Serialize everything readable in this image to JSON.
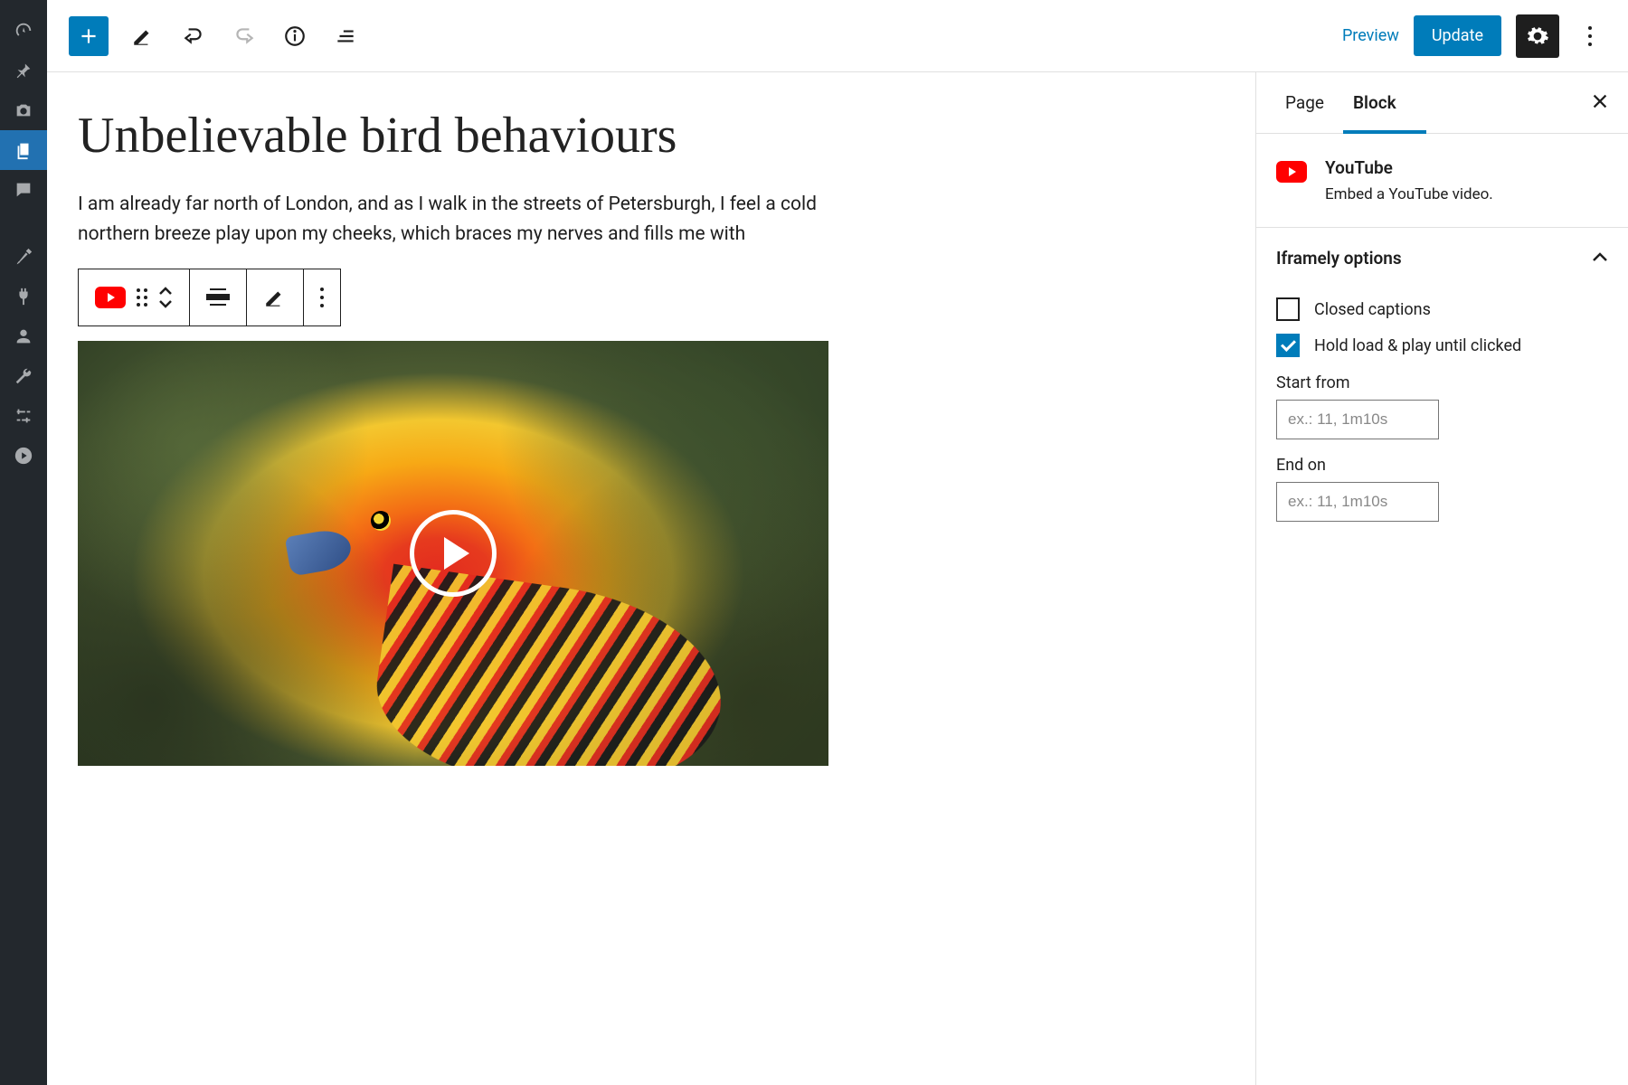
{
  "toolbar": {
    "preview_label": "Preview",
    "update_label": "Update"
  },
  "post": {
    "title": "Unbelievable bird behaviours",
    "paragraph": "I am already far north of London, and as I walk in the streets of Petersburgh, I feel a cold northern breeze play upon my cheeks, which braces my nerves and fills me with"
  },
  "sidebar": {
    "tabs": {
      "page": "Page",
      "block": "Block"
    },
    "block": {
      "name": "YouTube",
      "description": "Embed a YouTube video."
    },
    "section_title": "Iframely options",
    "options": {
      "closed_captions": {
        "label": "Closed captions",
        "checked": false
      },
      "hold_load": {
        "label": "Hold load & play until clicked",
        "checked": true
      }
    },
    "fields": {
      "start": {
        "label": "Start from",
        "placeholder": "ex.: 11, 1m10s",
        "value": ""
      },
      "end": {
        "label": "End on",
        "placeholder": "ex.: 11, 1m10s",
        "value": ""
      }
    }
  },
  "colors": {
    "accent": "#007cba",
    "youtube": "#ff0000"
  }
}
